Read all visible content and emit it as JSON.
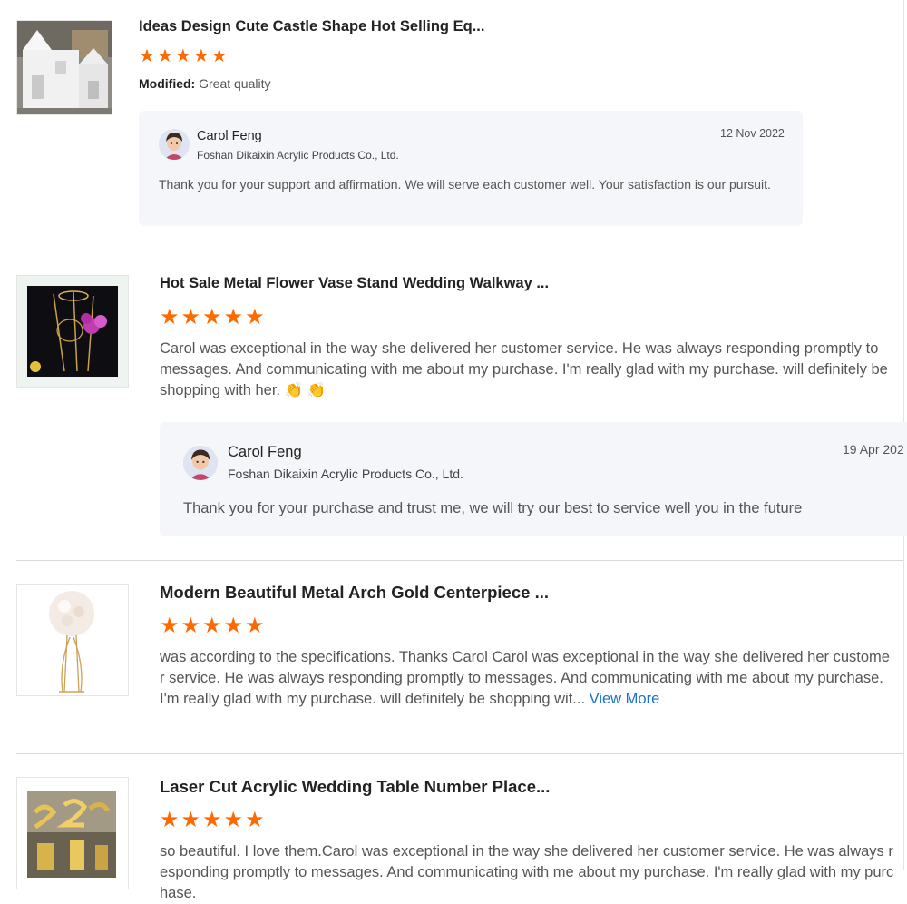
{
  "reviews": [
    {
      "title": "Ideas Design Cute Castle Shape Hot Selling Eq...",
      "stars": 5,
      "modified_label": "Modified:",
      "modified_text": "Great quality",
      "thumb_icon": "castle-product-image",
      "reply": {
        "name": "Carol Feng",
        "company": "Foshan Dikaixin Acrylic Products Co., Ltd.",
        "date": "12 Nov 2022",
        "text": "Thank you for your support and affirmation. We will serve each customer well. Your satisfaction is our pursuit."
      }
    },
    {
      "title": "Hot Sale Metal Flower Vase Stand Wedding Walkway ...",
      "stars": 5,
      "text": "Carol was exceptional in the way she delivered her customer service.  He was always responding promptly to messages. And communicating with me about my purchase.  I'm really glad with my purchase.  will definitely be shopping with her. 👏 👏",
      "thumb_icon": "flower-vase-stand-product-image",
      "reply": {
        "name": "Carol Feng",
        "company": "Foshan Dikaixin Acrylic Products Co., Ltd.",
        "date": "19 Apr 202",
        "text": "Thank you for your purchase and trust me, we will try our best to service well you in the future"
      }
    },
    {
      "title": "Modern Beautiful Metal Arch Gold Centerpiece ...",
      "stars": 5,
      "text": "was according to the specifications.  Thanks Carol Carol was exceptional in the way she delivered her customer service.  He was always responding promptly to messages. And communicating with me about my purchase.  I'm really glad with my purchase.  will definitely be shopping wit...",
      "view_more": "View More",
      "thumb_icon": "flower-ball-centerpiece-product-image"
    },
    {
      "title": "Laser Cut Acrylic Wedding Table Number Place...",
      "stars": 5,
      "text": "so beautiful.  I love them.Carol was exceptional in the way she delivered her customer service.  He was always responding promptly to messages. And communicating with me about my purchase.  I'm really glad with my purchase.",
      "thumb_icon": "table-number-product-image"
    }
  ],
  "colors": {
    "star": "#ff6a00",
    "link": "#1a73c8",
    "reply_bg": "#f5f6f9"
  }
}
